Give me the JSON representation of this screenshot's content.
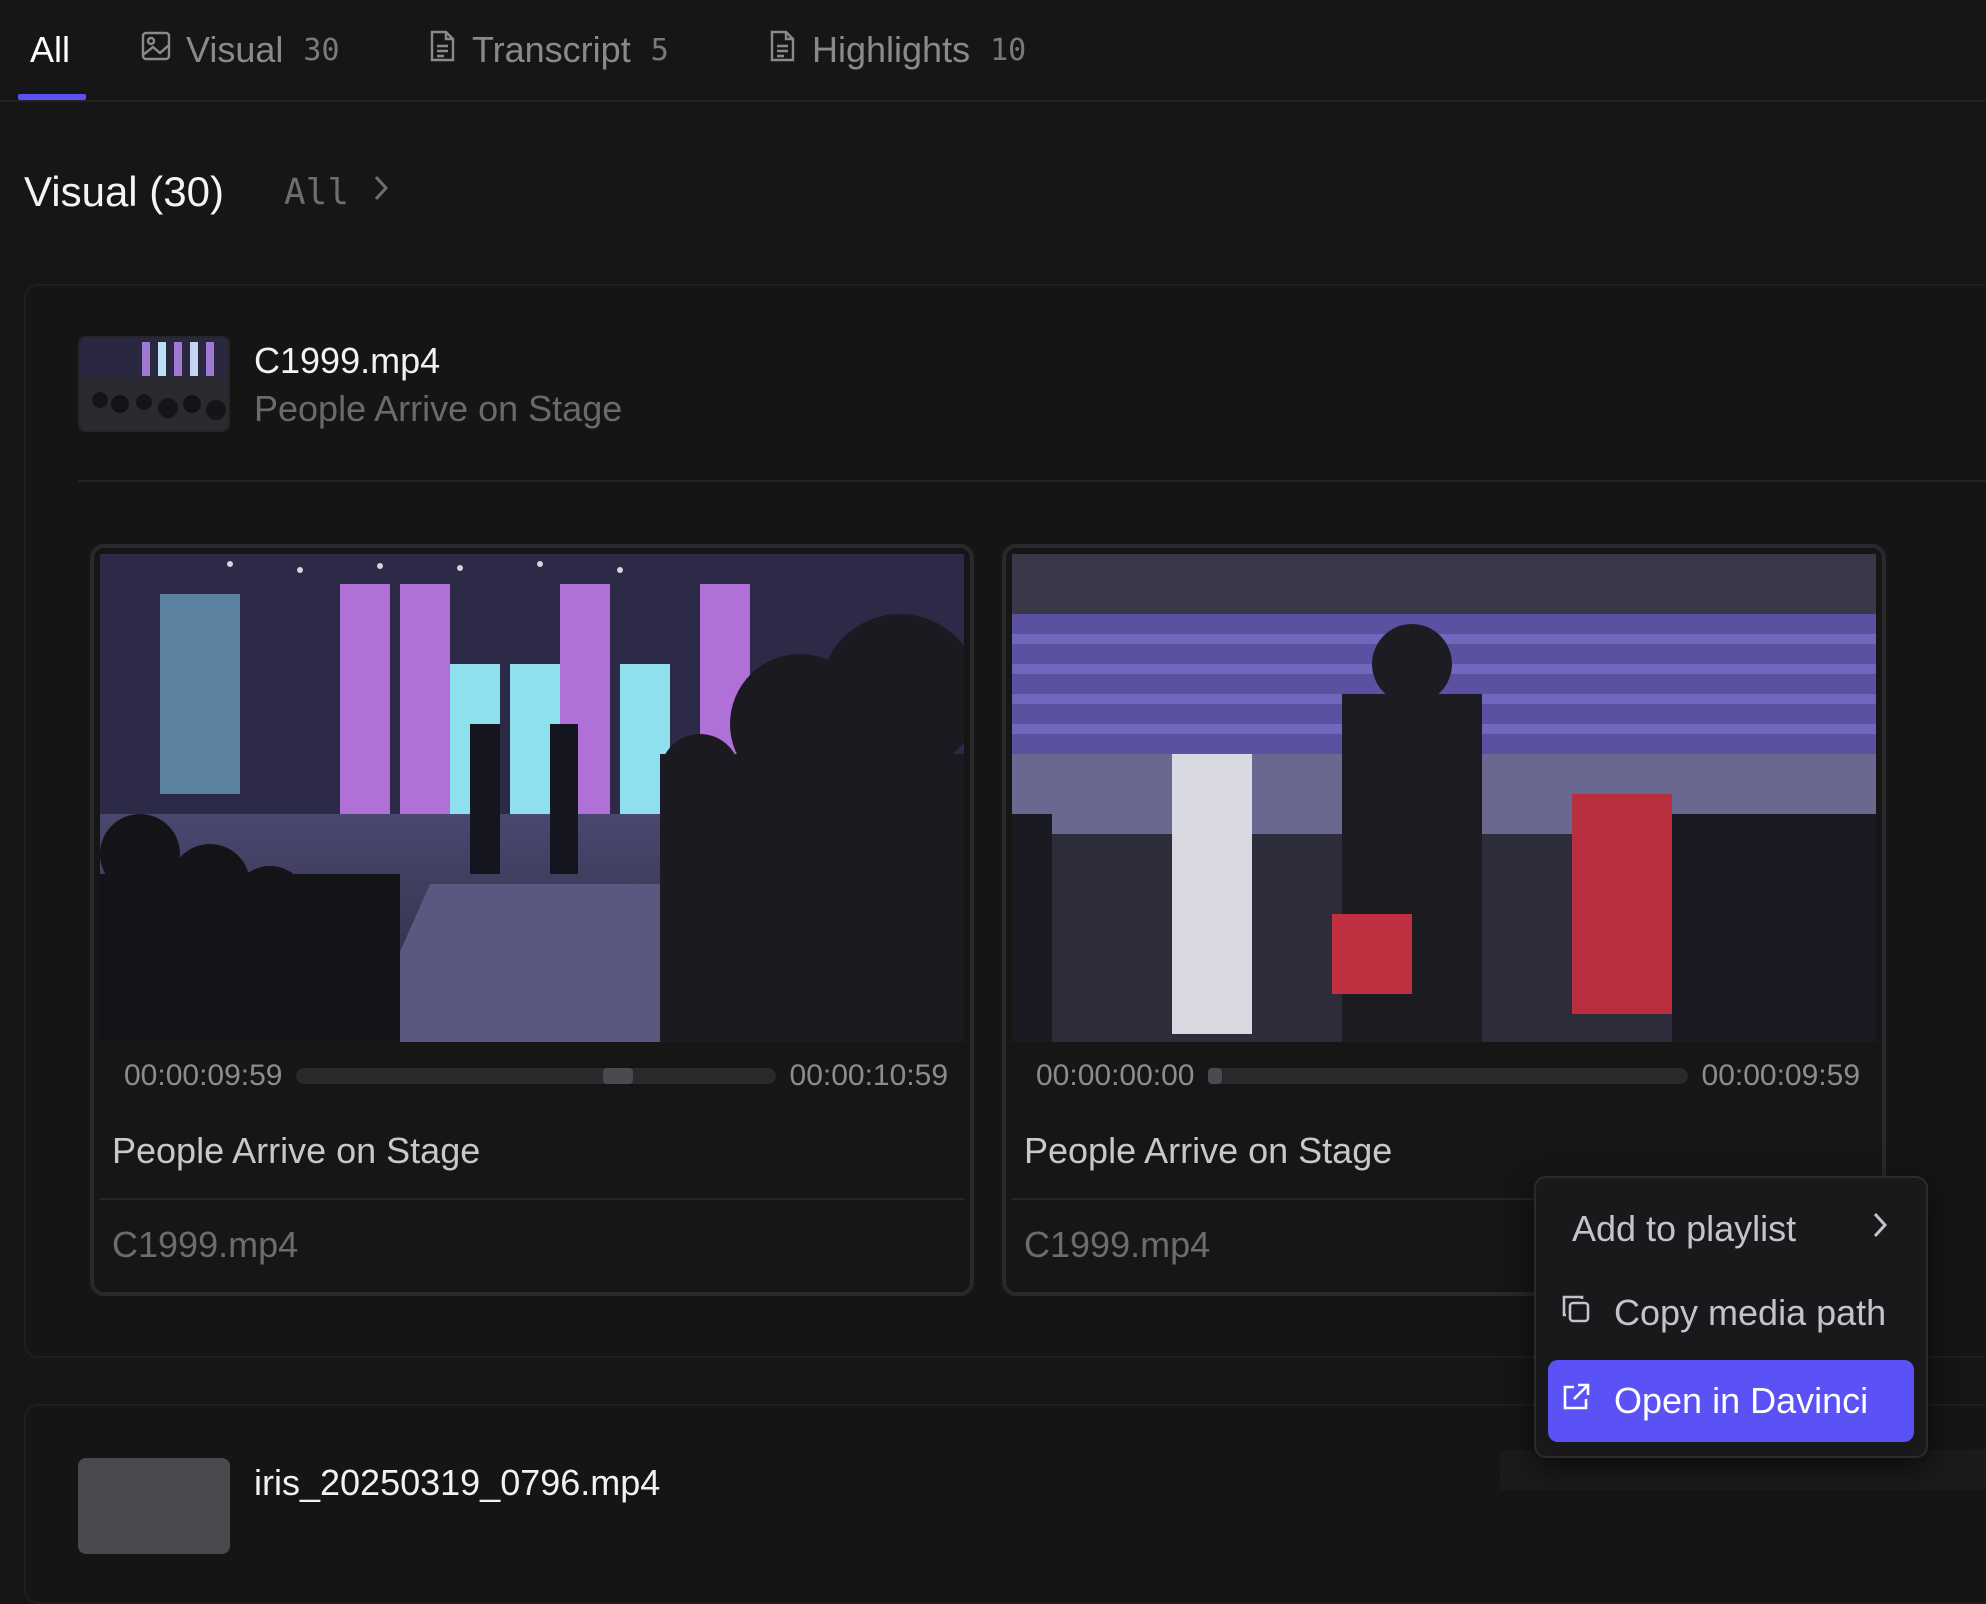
{
  "tabs": [
    {
      "label": "All",
      "count": "",
      "icon": "none"
    },
    {
      "label": "Visual",
      "count": "30",
      "icon": "image-icon"
    },
    {
      "label": "Transcript",
      "count": "5",
      "icon": "document-icon"
    },
    {
      "label": "Highlights",
      "count": "10",
      "icon": "document-icon"
    }
  ],
  "accent_color": "#5b52f5",
  "section": {
    "title": "Visual (30)",
    "all_link": "All"
  },
  "groups": [
    {
      "file": "C1999.mp4",
      "description": "People Arrive on Stage",
      "clips": [
        {
          "start": "00:00:09:59",
          "end": "00:00:10:59",
          "progress": 0.66,
          "title": "People Arrive on Stage",
          "file": "C1999.mp4"
        },
        {
          "start": "00:00:00:00",
          "end": "00:00:09:59",
          "progress": 0.0,
          "title": "People Arrive on Stage",
          "file": "C1999.mp4"
        }
      ]
    },
    {
      "file": "iris_20250319_0796.mp4"
    }
  ],
  "context_menu": {
    "items": [
      {
        "label": "Add to playlist",
        "icon": "chevron-right-icon"
      },
      {
        "label": "Copy media path",
        "icon": "copy-icon"
      },
      {
        "label": "Open in Davinci",
        "icon": "external-link-icon"
      }
    ]
  }
}
